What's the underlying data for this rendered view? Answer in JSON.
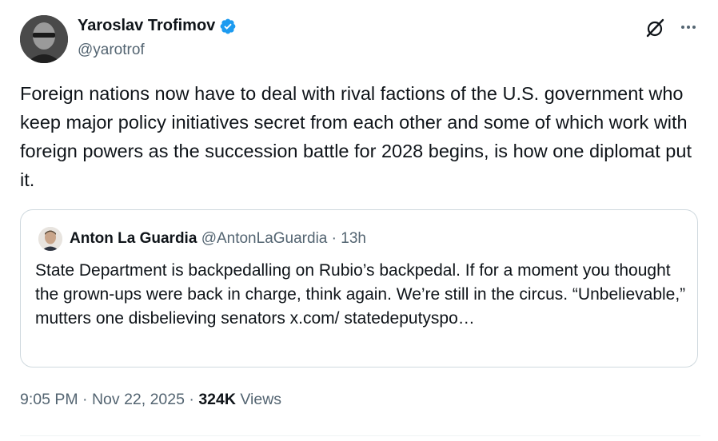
{
  "author": {
    "name": "Yaroslav Trofimov",
    "handle": "@yarotrof",
    "verified_icon": "verified-badge-icon",
    "verified_color": "#1d9bf0"
  },
  "actions": {
    "grok_icon": "grok-icon",
    "more_icon": "more-options-icon"
  },
  "tweet": {
    "text": "Foreign nations now have to deal with rival factions of the U.S. government who keep major policy initiatives secret from each other and some of which work with foreign powers as the succession battle for 2028 begins, is how one diplomat put it."
  },
  "quote": {
    "name": "Anton La Guardia",
    "handle": "@AntonLaGuardia",
    "separator": " · ",
    "time": "13h",
    "text": "State Department is backpedalling on Rubio’s backpedal. If for a moment you thought the grown-ups were back in charge, think again. We’re still in the circus. “Unbelievable,” mutters one disbelieving senators x.com/ statedeputyspo…"
  },
  "meta": {
    "time": "9:05 PM",
    "separator": " · ",
    "date": "Nov 22, 2025",
    "views_count": "324K",
    "views_label": "Views"
  },
  "colors": {
    "text_primary": "#0f1419",
    "text_secondary": "#536471",
    "border": "#cfd9de"
  }
}
